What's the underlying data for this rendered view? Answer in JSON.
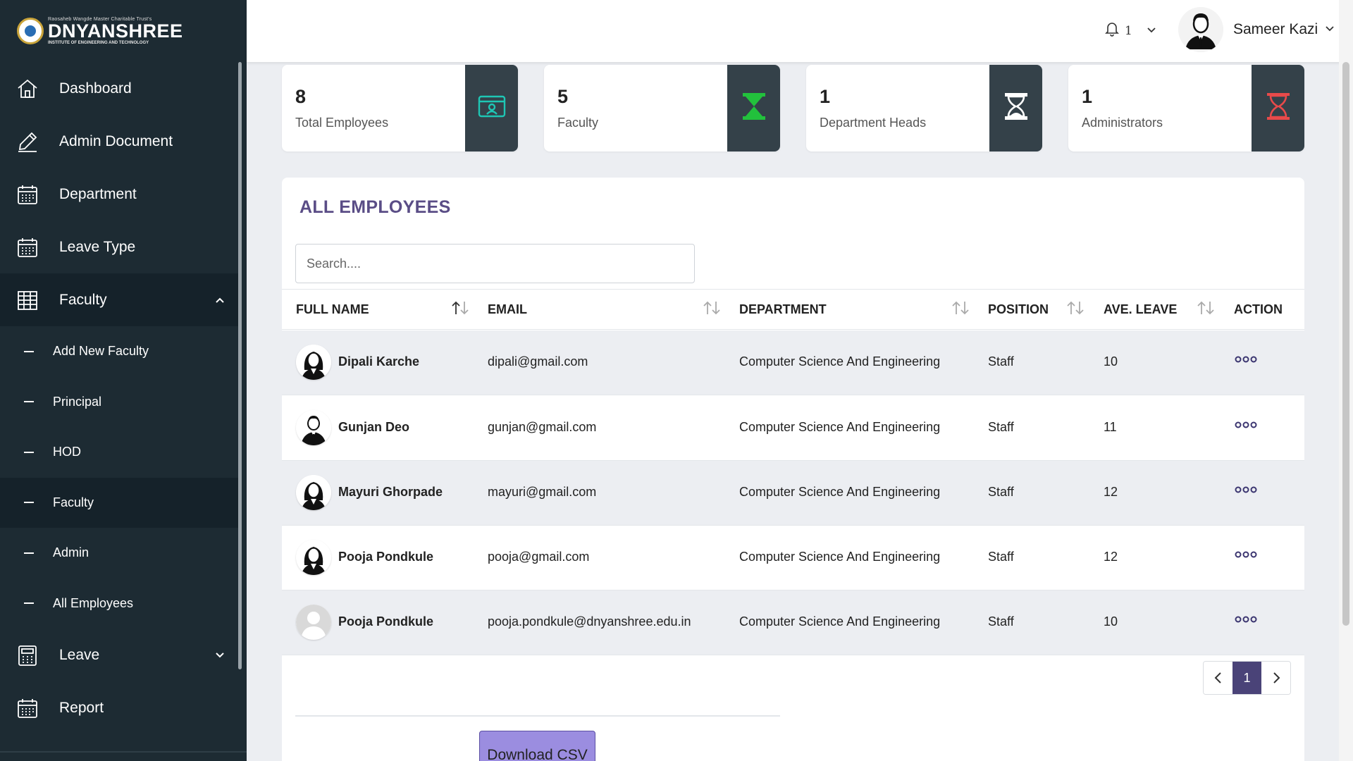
{
  "brand": {
    "tagline": "Raosaheb Wangde Master Charitable Trust's",
    "name": "DNYANSHREE",
    "subtitle": "INSTITUTE OF ENGINEERING AND TECHNOLOGY"
  },
  "sidebar": {
    "items": [
      {
        "label": "Dashboard",
        "icon": "home-icon"
      },
      {
        "label": "Admin Document",
        "icon": "pencil-icon"
      },
      {
        "label": "Department",
        "icon": "calendar-icon"
      },
      {
        "label": "Leave Type",
        "icon": "calendar-icon"
      },
      {
        "label": "Faculty",
        "icon": "table-icon",
        "expanded": true
      },
      {
        "label": "Leave",
        "icon": "calculator-icon",
        "expanded": false
      },
      {
        "label": "Report",
        "icon": "calendar-icon"
      }
    ],
    "faculty_sub": [
      {
        "label": "Add New Faculty"
      },
      {
        "label": "Principal"
      },
      {
        "label": "HOD"
      },
      {
        "label": "Faculty",
        "active": true
      },
      {
        "label": "Admin"
      },
      {
        "label": "All Employees"
      }
    ]
  },
  "header": {
    "notification_count": "1",
    "user_name": "Sameer Kazi"
  },
  "stats": [
    {
      "value": "8",
      "label": "Total Employees",
      "icon": "id-card-icon",
      "icon_color": "#1ec6b4"
    },
    {
      "value": "5",
      "label": "Faculty",
      "icon": "hourglass-icon",
      "icon_color": "#22c13c"
    },
    {
      "value": "1",
      "label": "Department Heads",
      "icon": "hourglass-icon",
      "icon_color": "#ffffff"
    },
    {
      "value": "1",
      "label": "Administrators",
      "icon": "hourglass-icon",
      "icon_color": "#e84a4a"
    }
  ],
  "table": {
    "title": "ALL EMPLOYEES",
    "search_placeholder": "Search....",
    "columns": [
      "FULL NAME",
      "EMAIL",
      "DEPARTMENT",
      "POSITION",
      "AVE. LEAVE",
      "ACTION"
    ],
    "rows": [
      {
        "name": "Dipali Karche",
        "email": "dipali@gmail.com",
        "department": "Computer Science And Engineering",
        "position": "Staff",
        "leave": "10",
        "avatar": "female-avatar-icon"
      },
      {
        "name": "Gunjan Deo",
        "email": "gunjan@gmail.com",
        "department": "Computer Science And Engineering",
        "position": "Staff",
        "leave": "11",
        "avatar": "male-avatar-icon"
      },
      {
        "name": "Mayuri Ghorpade",
        "email": "mayuri@gmail.com",
        "department": "Computer Science And Engineering",
        "position": "Staff",
        "leave": "12",
        "avatar": "female-avatar-icon"
      },
      {
        "name": "Pooja Pondkule",
        "email": "pooja@gmail.com",
        "department": "Computer Science And Engineering",
        "position": "Staff",
        "leave": "12",
        "avatar": "female-avatar-icon"
      },
      {
        "name": "Pooja Pondkule",
        "email": "pooja.pondkule@dnyanshree.edu.in",
        "department": "Computer Science And Engineering",
        "position": "Staff",
        "leave": "10",
        "avatar": "default-avatar-icon"
      }
    ],
    "pagination": {
      "current_page": "1"
    },
    "download_label": "Download CSV"
  },
  "colors": {
    "sidebar_bg": "#1d2b33",
    "title_purple": "#5a4d86",
    "page_active": "#4a4378",
    "csv_button": "#9b8de0"
  }
}
